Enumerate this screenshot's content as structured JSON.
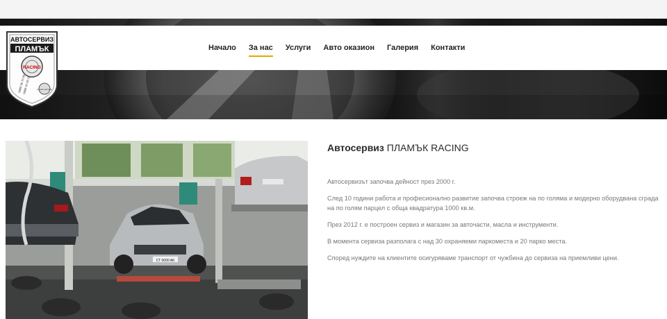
{
  "logo": {
    "line1": "АВТОСЕРВИЗ",
    "line2": "ПЛАМЪК",
    "badge": "RACING",
    "phone1": "0888 39 70 09",
    "phone2": "0888 42 09 11",
    "stamp": "СТАРА ЗАГОРА"
  },
  "nav": {
    "items": [
      {
        "label": "Начало",
        "active": false
      },
      {
        "label": "За нас",
        "active": true
      },
      {
        "label": "Услуги",
        "active": false
      },
      {
        "label": "Авто оказион",
        "active": false
      },
      {
        "label": "Галерия",
        "active": false
      },
      {
        "label": "Контакти",
        "active": false
      }
    ],
    "accent_color": "#e0a800"
  },
  "about": {
    "title_bold": "Автосервиз",
    "title_rest": "ПЛАМЪК RACING",
    "paragraphs": [
      "Автосервизът започва дейност през 2000 г.",
      "След 10 години работа и професионално развитие започва строеж на по голяма и модерно оборудвана сграда на по голям парцел с обща квадратура 1000 кв.м.",
      "През 2012 г. е построен сервиз и магазин за авточасти, масла и инструменти.",
      "В момента сервиза разполага с над 30 охраняеми паркоместа и 20 парко места.",
      "Според нуждите на клиентите осигуряваме транспорт от чужбина до сервиза на приемливи цени."
    ]
  },
  "photo": {
    "plate": "CT 0000 AK"
  }
}
